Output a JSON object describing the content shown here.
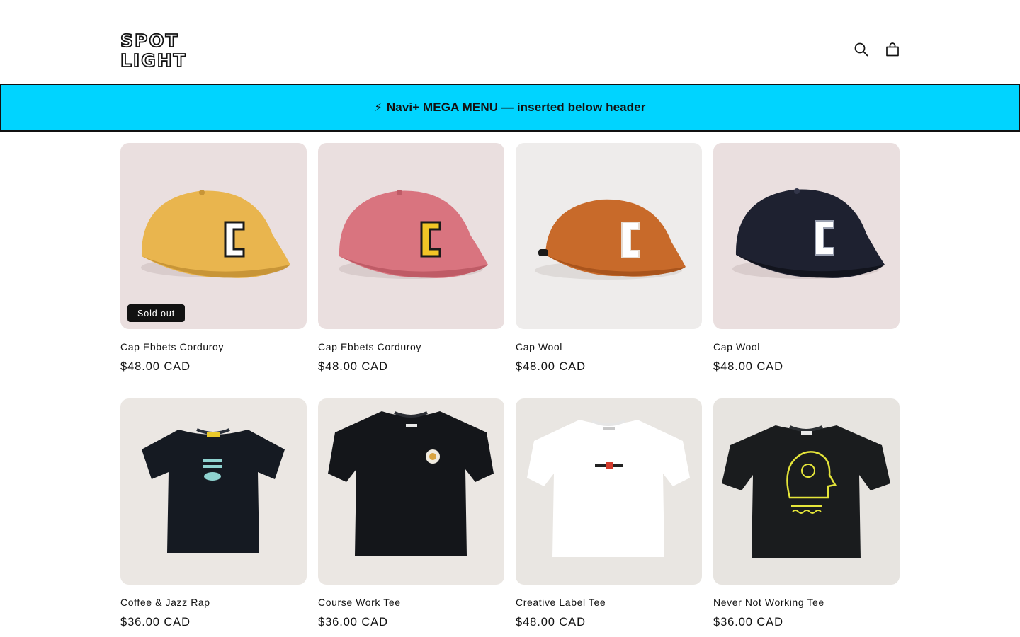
{
  "store": {
    "logo_line1": "SPOT",
    "logo_line2": "LIGHT"
  },
  "header": {
    "icons": [
      "search-icon",
      "cart-icon"
    ]
  },
  "banner": {
    "icon": "lightning-bolt-icon",
    "text": "Navi+ MEGA MENU — inserted below header",
    "background": "#00d4ff"
  },
  "products": [
    {
      "title": "Cap Ebbets Corduroy",
      "price": "$48.00 CAD",
      "badge": "Sold out",
      "color": "#e9b54e"
    },
    {
      "title": "Cap Ebbets Corduroy",
      "price": "$48.00 CAD",
      "badge": "",
      "color": "#d9747f"
    },
    {
      "title": "Cap Wool",
      "price": "$48.00 CAD",
      "badge": "",
      "color": "#c86a2a"
    },
    {
      "title": "Cap Wool",
      "price": "$48.00 CAD",
      "badge": "",
      "color": "#1e2130"
    },
    {
      "title": "Coffee & Jazz Rap",
      "price": "$36.00 CAD",
      "badge": "",
      "color": "#151a22"
    },
    {
      "title": "Course Work Tee",
      "price": "$36.00 CAD",
      "badge": "",
      "color": "#14161a"
    },
    {
      "title": "Creative Label Tee",
      "price": "$48.00 CAD",
      "badge": "",
      "color": "#ffffff"
    },
    {
      "title": "Never Not Working Tee",
      "price": "$36.00 CAD",
      "badge": "",
      "color": "#1a1c1e"
    }
  ]
}
